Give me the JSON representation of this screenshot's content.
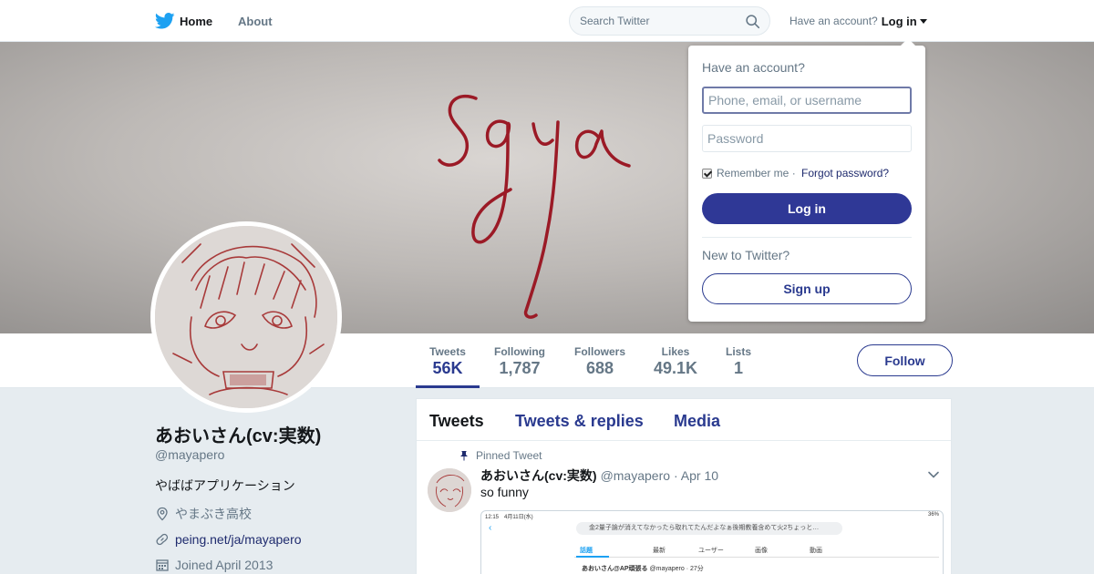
{
  "colors": {
    "accent": "#2a3a8f",
    "link": "#1f2b6e",
    "muted": "#657786",
    "twitter_blue": "#1da1f2"
  },
  "nav": {
    "home": "Home",
    "about": "About",
    "search_placeholder": "Search Twitter",
    "have_account": "Have an account?",
    "login": "Log in",
    "icons": [
      "twitter-bird-icon",
      "search-icon",
      "caret-down-icon"
    ]
  },
  "banner": {
    "handwriting": "Sgya"
  },
  "profile": {
    "name": "あおいさん(cv:実数)",
    "handle": "@mayapero",
    "bio": "やばばアプリケーション",
    "location": "やまぶき高校",
    "website": "peing.net/ja/mayapero",
    "joined": "Joined April 2013"
  },
  "stats": [
    {
      "label": "Tweets",
      "value": "56K",
      "active": true
    },
    {
      "label": "Following",
      "value": "1,787"
    },
    {
      "label": "Followers",
      "value": "688"
    },
    {
      "label": "Likes",
      "value": "49.1K"
    },
    {
      "label": "Lists",
      "value": "1"
    }
  ],
  "follow_label": "Follow",
  "timeline": {
    "tabs": [
      "Tweets",
      "Tweets & replies",
      "Media"
    ],
    "pinned_label": "Pinned Tweet",
    "tweet": {
      "name": "あおいさん(cv:実数)",
      "handle": "@mayapero",
      "date": "· Apr 10",
      "text": "so funny"
    },
    "media": {
      "status_left": "12:15　4月11日(水)",
      "status_right": "36%",
      "search_text": "金2量子論が消えてなかったら取れてたんだよなぁ後期教養含めて火2ちょっと…",
      "tabs": [
        "話題",
        "最新",
        "ユーザー",
        "画像",
        "動画"
      ],
      "row_name": "あおいさん@AP頑張る",
      "row_meta": "@mayapero · 27分"
    }
  },
  "login_dropdown": {
    "title": "Have an account?",
    "username_placeholder": "Phone, email, or username",
    "password_placeholder": "Password",
    "remember": "Remember me",
    "dot": " · ",
    "forgot": "Forgot password?",
    "login_button": "Log in",
    "new_to": "New to Twitter?",
    "signup_button": "Sign up",
    "remember_checked": true
  }
}
